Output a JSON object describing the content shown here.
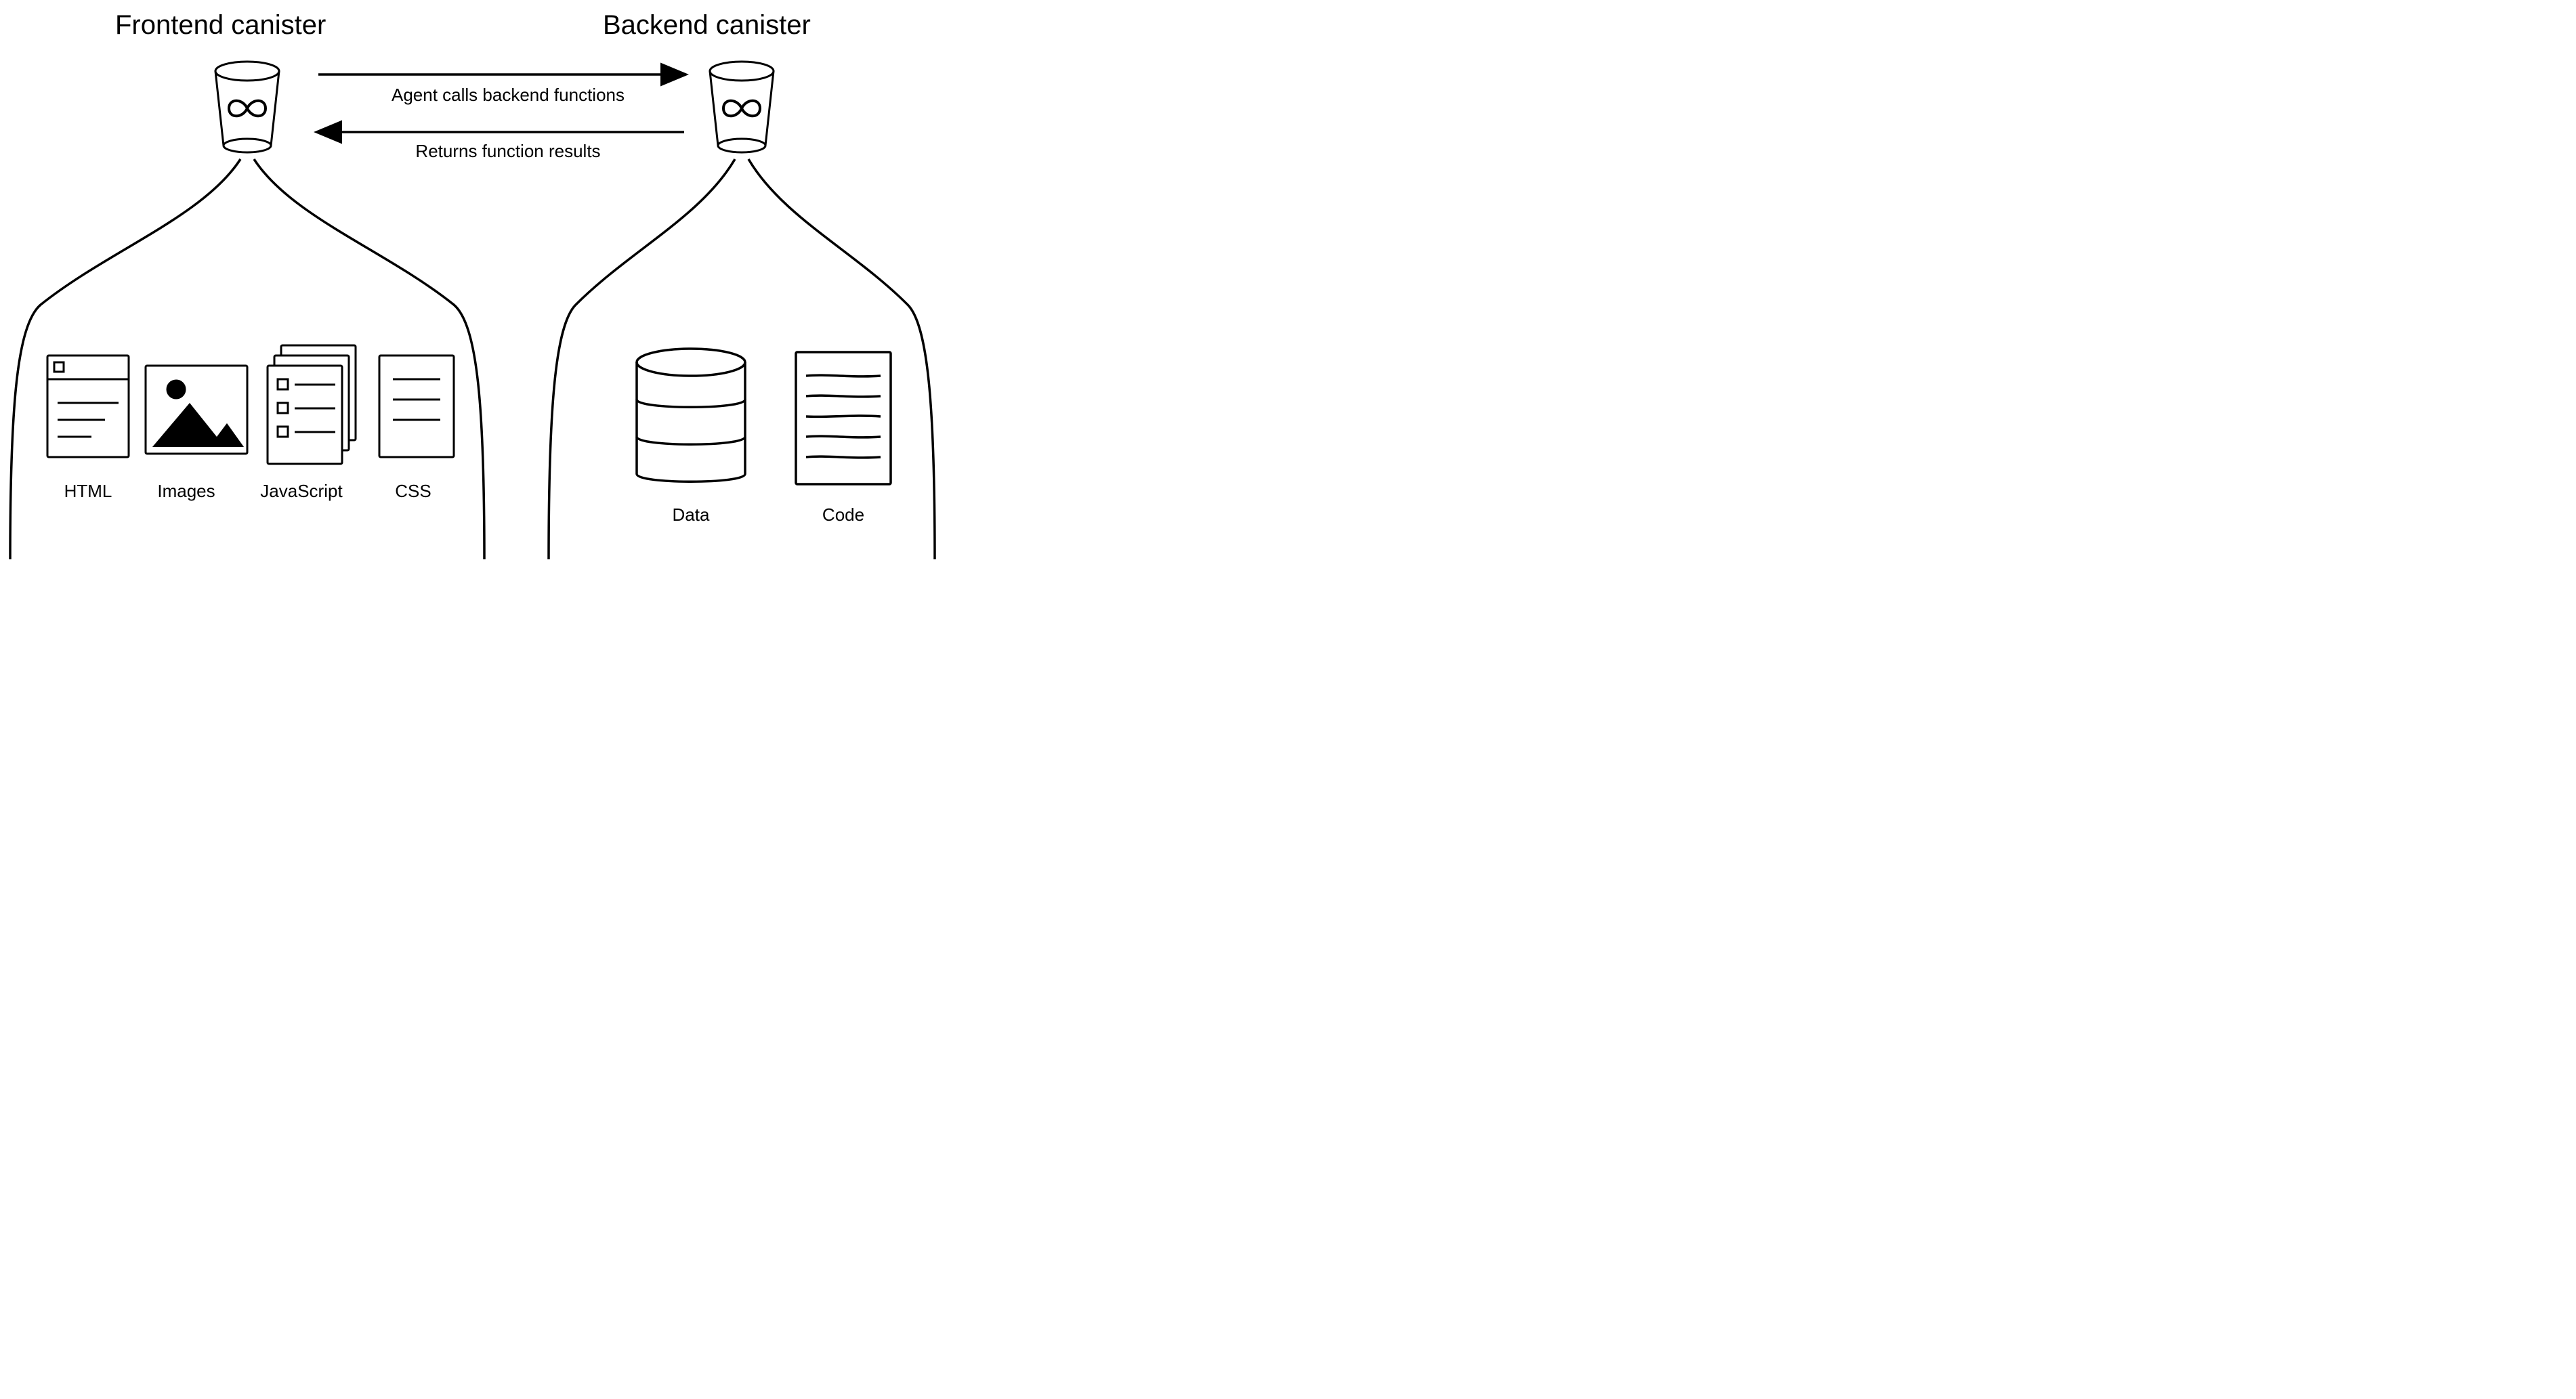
{
  "diagram": {
    "frontend": {
      "title": "Frontend canister",
      "items": [
        {
          "name": "html",
          "label": "HTML"
        },
        {
          "name": "images",
          "label": "Images"
        },
        {
          "name": "javascript",
          "label": "JavaScript"
        },
        {
          "name": "css",
          "label": "CSS"
        }
      ]
    },
    "backend": {
      "title": "Backend canister",
      "items": [
        {
          "name": "data",
          "label": "Data"
        },
        {
          "name": "code",
          "label": "Code"
        }
      ]
    },
    "arrows": {
      "forward": "Agent calls backend functions",
      "backward": "Returns function results"
    }
  }
}
